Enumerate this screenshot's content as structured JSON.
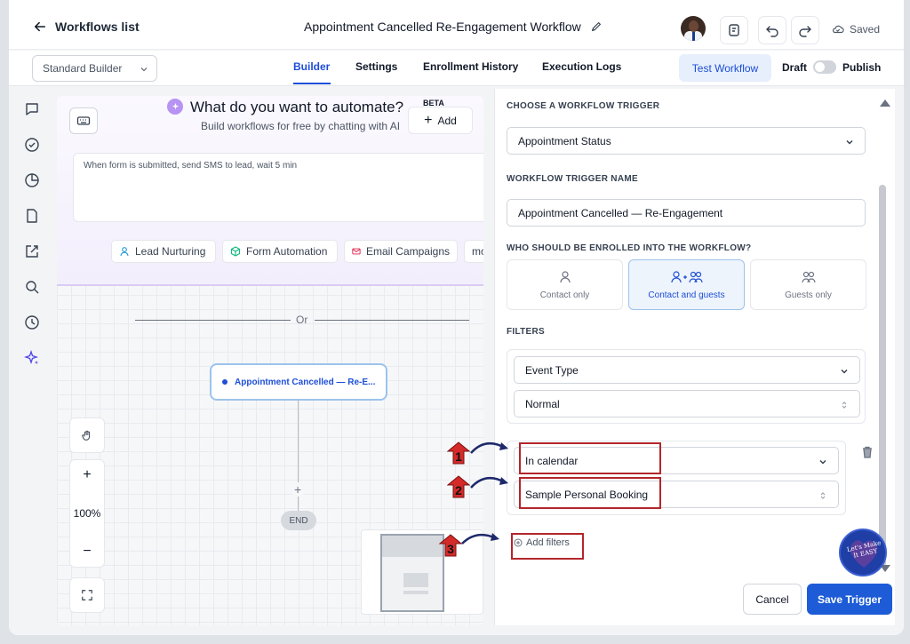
{
  "topbar": {
    "back_label": "Workflows list",
    "workflow_title": "Appointment Cancelled Re-Engagement Workflow",
    "saved_label": "Saved"
  },
  "secondbar": {
    "builder_select": "Standard Builder",
    "tabs": [
      {
        "label": "Builder"
      },
      {
        "label": "Settings"
      },
      {
        "label": "Enrollment History"
      },
      {
        "label": "Execution Logs"
      }
    ],
    "test_workflow": "Test Workflow",
    "draft": "Draft",
    "publish": "Publish"
  },
  "sidebar": {
    "icons": [
      "chat-icon",
      "check-circle-icon",
      "pie-chart-icon",
      "document-icon",
      "external-link-icon",
      "search-icon",
      "history-icon",
      "sparkle-icon"
    ]
  },
  "ai": {
    "title": "What do you want to automate?",
    "beta": "BETA",
    "subtitle": "Build workflows for free by chatting with AI",
    "add_label": "Add",
    "prompt_placeholder": "When form is submitted, send SMS to lead, wait 5 min",
    "chips": [
      "Lead Nurturing",
      "Form Automation",
      "Email Campaigns",
      "mo"
    ]
  },
  "canvas": {
    "or_label": "Or",
    "trigger_node_label": "Appointment Cancelled — Re-E...",
    "plus": "+",
    "end_label": "END",
    "zoom_level": "100%",
    "zoom_in": "+",
    "zoom_out": "−"
  },
  "panel": {
    "choose_trigger_label": "CHOOSE A WORKFLOW TRIGGER",
    "trigger_value": "Appointment Status",
    "trigger_name_label": "WORKFLOW TRIGGER NAME",
    "trigger_name_value": "Appointment Cancelled — Re-Engagement",
    "enroll_label": "WHO SHOULD BE ENROLLED INTO THE WORKFLOW?",
    "enroll_options": [
      "Contact only",
      "Contact and guests",
      "Guests only"
    ],
    "filters_label": "FILTERS",
    "filter1_field": "Event Type",
    "filter1_value": "Normal",
    "filter2_field": "In calendar",
    "filter2_value": "Sample Personal Booking",
    "add_filters": "Add filters",
    "cancel": "Cancel",
    "save_trigger": "Save Trigger"
  },
  "annotations": {
    "callouts": [
      "1",
      "2",
      "3"
    ],
    "watermark": "Let's Make It EASY"
  },
  "colors": {
    "accent": "#1d4ed8",
    "primary_button": "#1d5cd6",
    "highlight_box": "#b3262b",
    "callout_fill": "#d42a2a"
  }
}
